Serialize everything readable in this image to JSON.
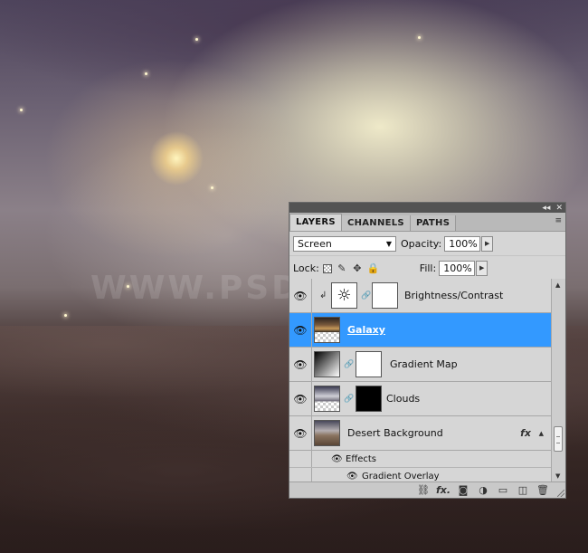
{
  "panel": {
    "top_controls": {
      "collapse": "◂◂",
      "close": "✕"
    },
    "tabs": [
      {
        "label": "LAYERS"
      },
      {
        "label": "CHANNELS"
      },
      {
        "label": "PATHS"
      }
    ],
    "menu_icon": "≡",
    "blend_mode": "Screen",
    "opacity_label": "Opacity:",
    "opacity_value": "100%",
    "lock_label": "Lock:",
    "fill_label": "Fill:",
    "fill_value": "100%",
    "layers": [
      {
        "name": "Brightness/Contrast",
        "type": "adjustment",
        "visible": true,
        "clipped": true
      },
      {
        "name": "Galaxy",
        "type": "pixel",
        "visible": true,
        "selected": true
      },
      {
        "name": "Gradient Map",
        "type": "adjustment",
        "visible": true
      },
      {
        "name": "Clouds",
        "type": "pixel-with-mask",
        "visible": true
      },
      {
        "name": "Desert Background",
        "type": "pixel",
        "visible": true,
        "has_effects": true
      }
    ],
    "effects_label": "Effects",
    "effect_items": [
      {
        "name": "Gradient Overlay"
      }
    ],
    "fx_label": "fx",
    "toolbar_icons": [
      "link-layers-icon",
      "fx-icon",
      "add-mask-icon",
      "adjustment-layer-icon",
      "group-folder-icon",
      "new-layer-icon",
      "trash-icon"
    ],
    "toolbar_fx": "fx.",
    "selection_color": "#3399ff"
  },
  "watermark": "WWW.PSD"
}
